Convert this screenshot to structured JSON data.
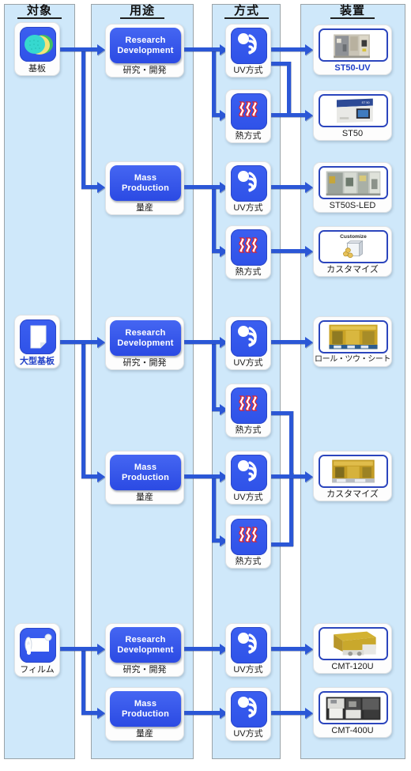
{
  "columns": [
    {
      "id": "target",
      "title": "対象"
    },
    {
      "id": "usage",
      "title": "用途"
    },
    {
      "id": "method",
      "title": "方式"
    },
    {
      "id": "device",
      "title": "装置"
    }
  ],
  "targets": [
    {
      "label": "基板",
      "icon": "substrate-disks-icon",
      "label_color": "#1a1a1a"
    },
    {
      "label": "大型基板",
      "icon": "large-substrate-icon",
      "label_color": "#2040c8"
    },
    {
      "label": "フィルム",
      "icon": "film-roll-icon",
      "label_color": "#1a1a1a"
    }
  ],
  "usages": [
    {
      "en": "Research Development",
      "jp": "研究・開発",
      "line1": "Research",
      "line2": "Development"
    },
    {
      "en": "Mass Production",
      "jp": "量産",
      "line1": "Mass",
      "line2": "Production"
    },
    {
      "en": "Research Development",
      "jp": "研究・開発",
      "line1": "Research",
      "line2": "Development"
    },
    {
      "en": "Mass Production",
      "jp": "量産",
      "line1": "Mass",
      "line2": "Production"
    },
    {
      "en": "Research Development",
      "jp": "研究・開発",
      "line1": "Research",
      "line2": "Development"
    },
    {
      "en": "Mass Production",
      "jp": "量産",
      "line1": "Mass",
      "line2": "Production"
    }
  ],
  "methods": [
    {
      "label": "UV方式",
      "icon": "uv-radiation-icon"
    },
    {
      "label": "熱方式",
      "icon": "heat-waves-icon"
    },
    {
      "label": "UV方式",
      "icon": "uv-radiation-icon"
    },
    {
      "label": "熱方式",
      "icon": "heat-waves-icon"
    },
    {
      "label": "UV方式",
      "icon": "uv-radiation-icon"
    },
    {
      "label": "熱方式",
      "icon": "heat-waves-icon"
    },
    {
      "label": "UV方式",
      "icon": "uv-radiation-icon"
    },
    {
      "label": "熱方式",
      "icon": "heat-waves-icon"
    },
    {
      "label": "UV方式",
      "icon": "uv-radiation-icon"
    },
    {
      "label": "UV方式",
      "icon": "uv-radiation-icon"
    }
  ],
  "devices": [
    {
      "label": "ST50-UV",
      "label_color": "#2040c8",
      "photo": "st50uv-machine-photo",
      "badge": ""
    },
    {
      "label": "ST50",
      "label_color": "#1a1a1a",
      "photo": "st50-machine-photo",
      "badge": ""
    },
    {
      "label": "ST50S-LED",
      "label_color": "#1a1a1a",
      "photo": "st50s-led-machine-photo",
      "badge": ""
    },
    {
      "label": "カスタマイズ",
      "label_color": "#1a1a1a",
      "photo": "customize-box-illustration",
      "badge": "Customize"
    },
    {
      "label": "ロール・ツウ・シート",
      "label_color": "#1a1a1a",
      "photo": "roll-to-sheet-line-photo",
      "badge": ""
    },
    {
      "label": "カスタマイズ",
      "label_color": "#1a1a1a",
      "photo": "customize-line-photo",
      "badge": ""
    },
    {
      "label": "CMT-120U",
      "label_color": "#1a1a1a",
      "photo": "cmt120u-machine-photo",
      "badge": ""
    },
    {
      "label": "CMT-400U",
      "label_color": "#1a1a1a",
      "photo": "cmt400u-machine-photo",
      "badge": ""
    }
  ],
  "colors": {
    "panel_bg": "#cfe8fa",
    "panel_border": "#9aa3a8",
    "connector": "#2b57d6",
    "node_blue": "#2f52e8",
    "accent_text": "#2040c8",
    "heat_red": "#e0202a",
    "page_bg": "#ffffff"
  }
}
